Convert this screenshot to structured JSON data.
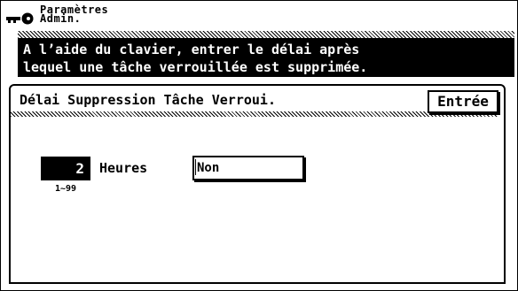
{
  "header": {
    "title_line1": "Paramètres",
    "title_line2": "Admin.",
    "icon": "key-icon"
  },
  "banner": {
    "line1": "A l’aide du clavier, entrer le délai après",
    "line2": "lequel une tâche verrouillée est supprimée."
  },
  "panel": {
    "title": "Délai Suppression Tâche Verroui.",
    "enter_label": "Entrée",
    "value": "2",
    "range": "1~99",
    "unit": "Heures",
    "non_label": "Non"
  }
}
